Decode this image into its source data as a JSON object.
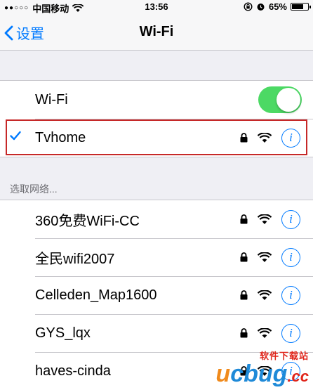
{
  "status_bar": {
    "signal": "●●○○○",
    "carrier": "中国移动",
    "time": "13:56",
    "battery": "65%",
    "battery_level": 0.65
  },
  "nav": {
    "back_label": "设置",
    "title": "Wi-Fi"
  },
  "wifi_toggle": {
    "label": "Wi-Fi",
    "on": true
  },
  "connected": {
    "name": "Tvhome",
    "locked": true,
    "highlighted": true
  },
  "section_header": "选取网络...",
  "networks": [
    {
      "name": "360免费WiFi-CC",
      "locked": true
    },
    {
      "name": "全民wifi2007",
      "locked": true
    },
    {
      "name": "Celleden_Map1600",
      "locked": true
    },
    {
      "name": "GYS_lqx",
      "locked": true
    },
    {
      "name": "haves-cinda",
      "locked": true
    }
  ],
  "watermark": {
    "cn": "软件下载站",
    "logo_u": "u",
    "logo_cbug": "cbug",
    "logo_cc": ".cc"
  },
  "colors": {
    "accent": "#007aff",
    "toggle_on": "#4cd964",
    "highlight": "#c62828"
  }
}
